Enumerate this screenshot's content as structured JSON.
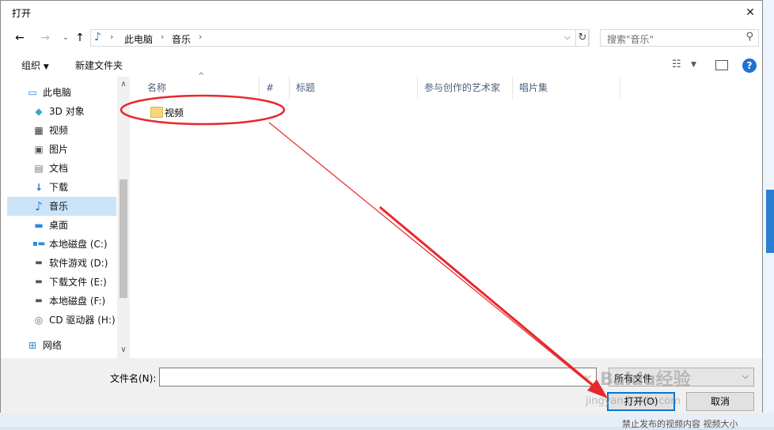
{
  "window": {
    "title": "打开"
  },
  "navbar": {
    "breadcrumb": [
      "此电脑",
      "音乐"
    ],
    "search_placeholder": "搜索\"音乐\""
  },
  "toolbar": {
    "organize": "组织",
    "new_folder": "新建文件夹"
  },
  "sidebar": {
    "items": [
      {
        "label": "此电脑",
        "icon": "computer-icon"
      },
      {
        "label": "3D 对象",
        "icon": "cube-icon"
      },
      {
        "label": "视频",
        "icon": "film-icon"
      },
      {
        "label": "图片",
        "icon": "picture-icon"
      },
      {
        "label": "文档",
        "icon": "document-icon"
      },
      {
        "label": "下载",
        "icon": "download-arrow-icon"
      },
      {
        "label": "音乐",
        "icon": "music-note-icon",
        "selected": true
      },
      {
        "label": "桌面",
        "icon": "desktop-icon"
      },
      {
        "label": "本地磁盘 (C:)",
        "icon": "windows-drive-icon"
      },
      {
        "label": "软件游戏 (D:)",
        "icon": "drive-icon"
      },
      {
        "label": "下载文件 (E:)",
        "icon": "drive-icon"
      },
      {
        "label": "本地磁盘 (F:)",
        "icon": "drive-icon"
      },
      {
        "label": "CD 驱动器 (H:)",
        "icon": "cd-drive-icon"
      },
      {
        "label": "网络",
        "icon": "network-icon"
      }
    ]
  },
  "columns": [
    "名称",
    "#",
    "标题",
    "参与创作的艺术家",
    "唱片集"
  ],
  "files": [
    {
      "name": "视频",
      "type": "folder"
    }
  ],
  "bottom": {
    "filename_label": "文件名(N):",
    "filename_value": "",
    "filter_value": "所有文件",
    "open_label": "打开(O)",
    "cancel_label": "取消"
  },
  "background_text": "禁止发布的视频内容    视频大小",
  "watermark": {
    "brand": "Baidu经验",
    "url": "jingyan.baidu.com"
  },
  "colors": {
    "accent": "#0078d7",
    "annotation": "#e8282b",
    "selection": "#cce4f7"
  }
}
